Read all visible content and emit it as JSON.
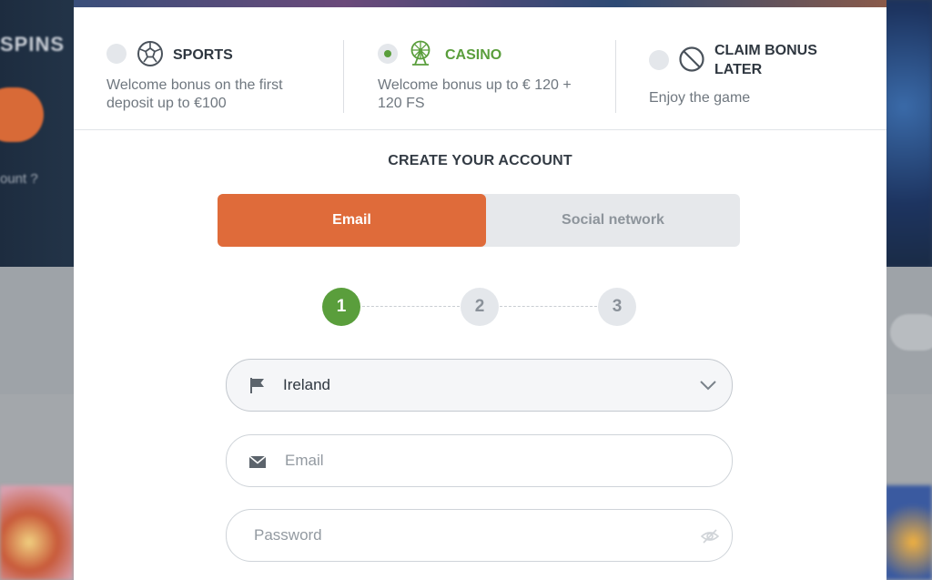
{
  "background": {
    "spins_text": "SPINS",
    "account_text": "ount ?"
  },
  "bonuses": [
    {
      "title": "SPORTS",
      "description": "Welcome bonus on the first deposit up to €100",
      "icon": "soccer-ball-icon",
      "selected": false
    },
    {
      "title": "CASINO",
      "description": "Welcome bonus up to € 120 + 120 FS",
      "icon": "ferris-wheel-icon",
      "selected": true
    },
    {
      "title": "CLAIM BONUS LATER",
      "description": "Enjoy the game",
      "icon": "no-entry-icon",
      "selected": false
    }
  ],
  "form": {
    "title": "CREATE YOUR ACCOUNT",
    "tabs": [
      {
        "label": "Email",
        "active": true
      },
      {
        "label": "Social network",
        "active": false
      }
    ],
    "steps": [
      "1",
      "2",
      "3"
    ],
    "active_step": 1,
    "country": {
      "value": "Ireland",
      "icon": "flag-icon"
    },
    "email": {
      "placeholder": "Email",
      "value": "",
      "icon": "envelope-icon"
    },
    "password": {
      "placeholder": "Password",
      "value": "",
      "icon": "eye-icon"
    }
  },
  "colors": {
    "accent_orange": "#df6b3a",
    "accent_green": "#5a9e3c"
  }
}
